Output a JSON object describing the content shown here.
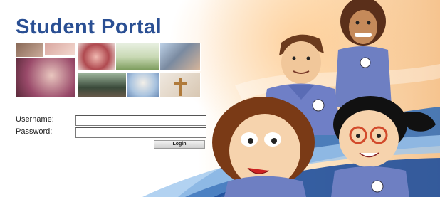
{
  "header": {
    "title": "Student Portal"
  },
  "login": {
    "username_label": "Username:",
    "password_label": "Password:",
    "username_value": "",
    "password_value": "",
    "login_button": "Login"
  },
  "colors": {
    "title": "#2a4f93",
    "swoosh_blue": "#2d6bb8",
    "warm_glow": "#f6c48f"
  }
}
